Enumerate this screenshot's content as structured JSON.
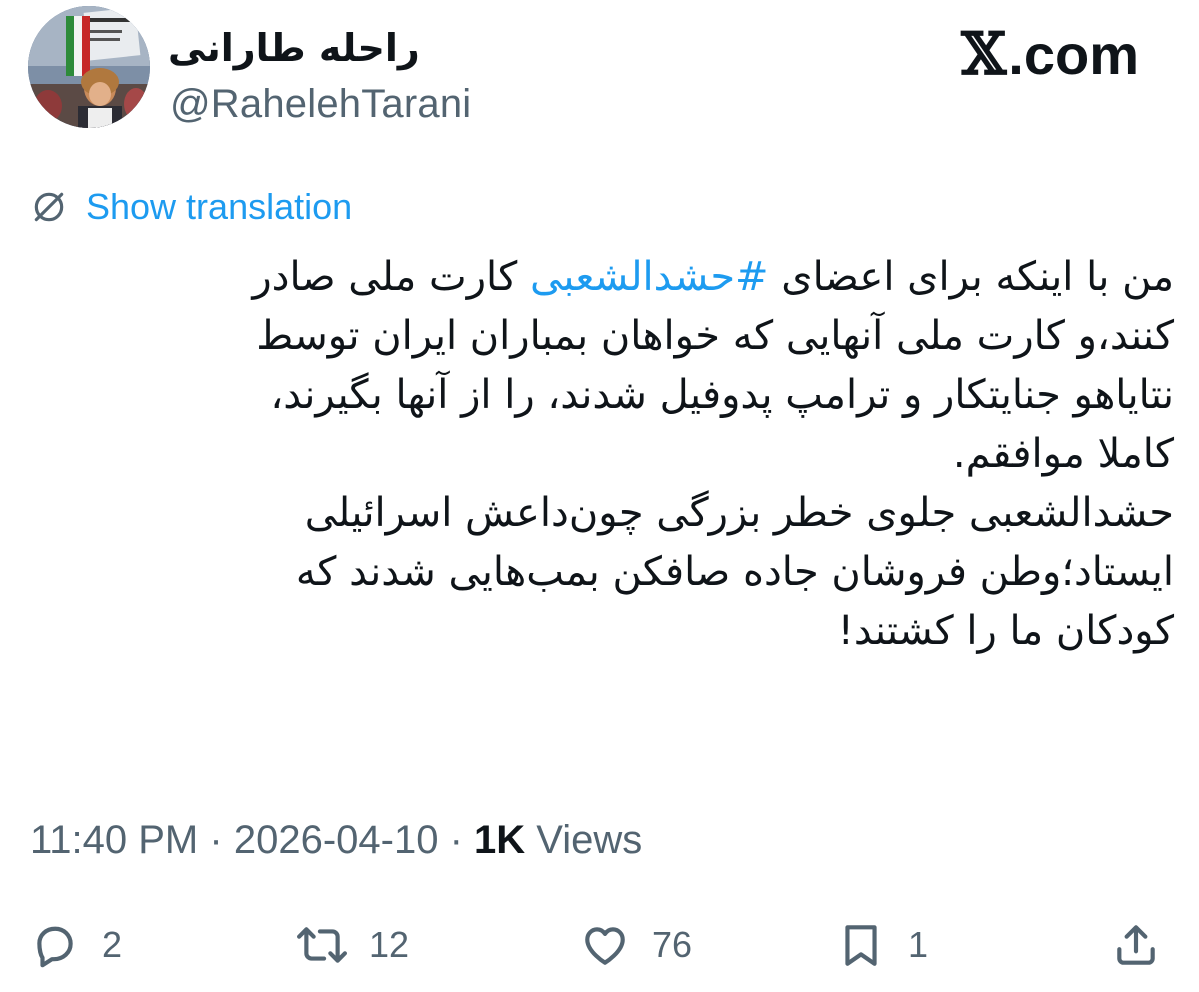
{
  "header": {
    "display_name": "راحله طارانی",
    "handle": "@RahelehTarani",
    "brand": ".com"
  },
  "translation": {
    "label": "Show translation"
  },
  "tweet": {
    "line1_before": "من با اینکه برای اعضای ",
    "hashtag": "#حشدالشعبی",
    "line1_after": " کارت ملی صادر",
    "line2": "کنند،و کارت ملی آنهایی که خواهان بمباران ایران توسط",
    "line3": "نتایاهو جنایتکار و ترامپ پدوفیل شدند، را از آنها بگیرند،",
    "line4": "کاملا موافقم.",
    "line5": "حشدالشعبی جلوی خطر بزرگی چون‌داعش اسرائیلی",
    "line6": "ایستاد؛وطن فروشان جاده صافکن بمب‌هایی شدند که",
    "line7": "کودکان ما را کشتند!"
  },
  "meta": {
    "time": "11:40 PM",
    "separator": "·",
    "date": "2026-04-10",
    "views_count": "1K",
    "views_label": "Views"
  },
  "actions": {
    "replies": "2",
    "reposts": "12",
    "likes": "76",
    "bookmarks": "1"
  },
  "colors": {
    "accent": "#1d9bf0",
    "secondary_text": "#536471",
    "primary_text": "#0f1419"
  }
}
